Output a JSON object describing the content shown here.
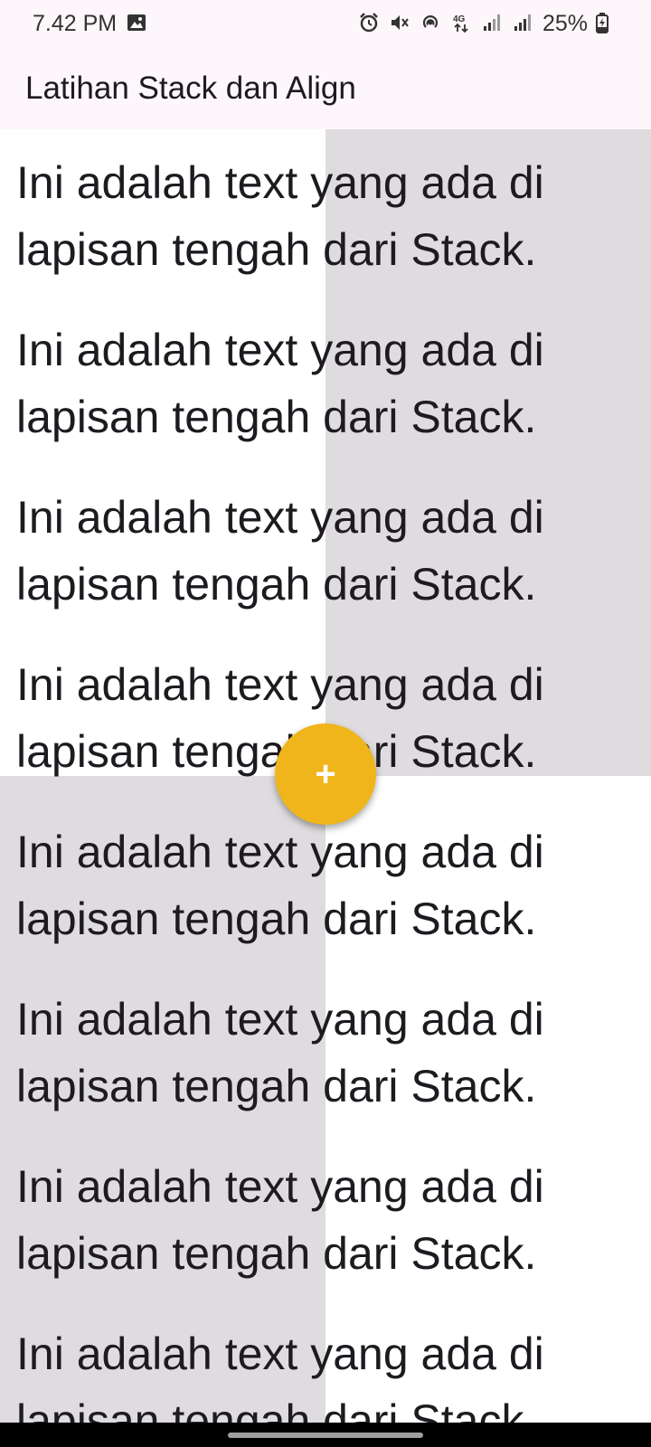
{
  "status_bar": {
    "time": "7.42 PM",
    "battery": "25%",
    "icons": [
      "image-icon",
      "alarm-icon",
      "mute-icon",
      "hotspot-icon",
      "4g-icon",
      "signal-icon",
      "signal-icon",
      "battery-charging-icon"
    ]
  },
  "app_bar": {
    "title": "Latihan Stack dan Align"
  },
  "content": {
    "paragraphs": [
      {
        "line1": "Ini adalah text yang ada di",
        "line2": "lapisan tengah dari Stack."
      },
      {
        "line1": "Ini adalah text yang ada di",
        "line2": "lapisan tengah dari Stack."
      },
      {
        "line1": "Ini adalah text yang ada di",
        "line2": "lapisan tengah dari Stack."
      },
      {
        "line1": "Ini adalah text yang ada di",
        "line2": "lapisan tengah dari Stack."
      },
      {
        "line1": "Ini adalah text yang ada di",
        "line2": "lapisan tengah dari Stack."
      },
      {
        "line1": "Ini adalah text yang ada di",
        "line2": "lapisan tengah dari Stack."
      },
      {
        "line1": "Ini adalah text yang ada di",
        "line2": "lapisan tengah dari Stack."
      },
      {
        "line1": "Ini adalah text yang ada di",
        "line2": "lapisan tengah dari Stack."
      }
    ]
  },
  "fab": {
    "icon": "plus-icon",
    "label": "+",
    "color": "#f0b51a"
  },
  "colors": {
    "grey_block": "#dedcde",
    "app_bar_bg": "#fdf6fa"
  }
}
